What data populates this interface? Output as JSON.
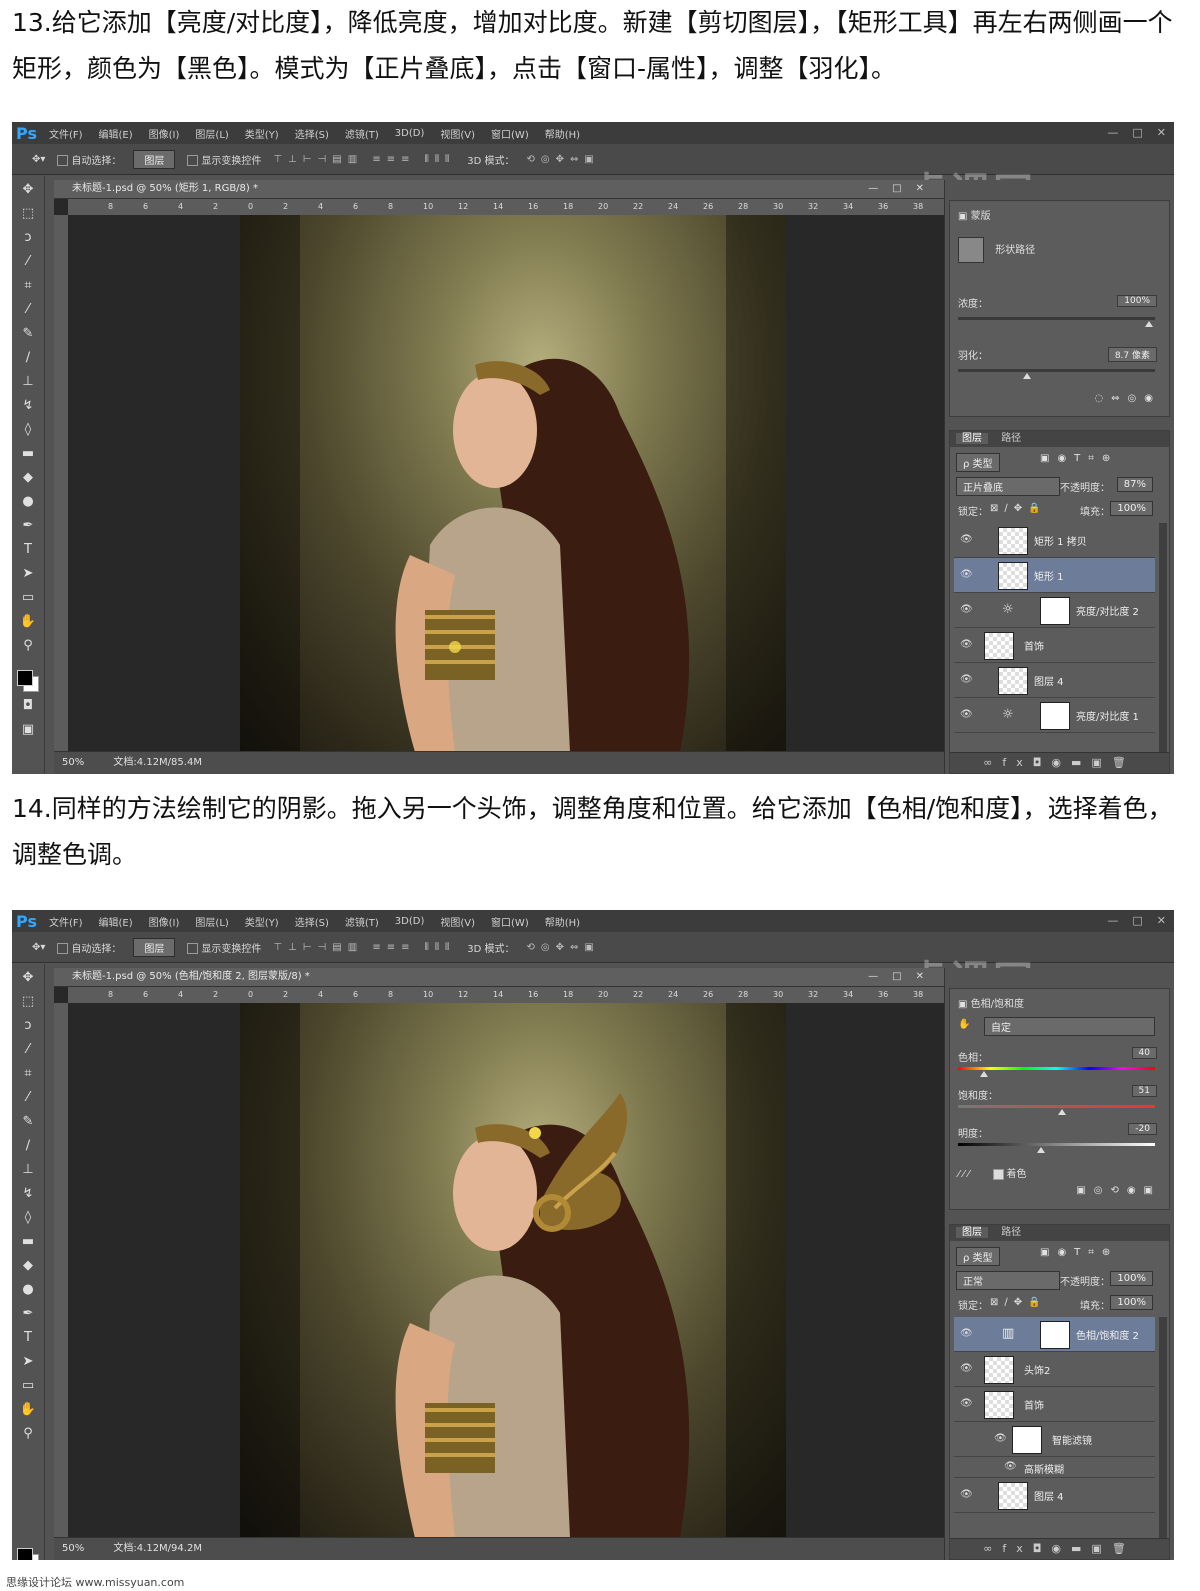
{
  "step13": {
    "text": "13.给它添加【亮度/对比度】，降低亮度，增加对比度。新建【剪切图层】，【矩形工具】再左右两侧画一个矩形，颜色为【黑色】。模式为【正片叠底】，点击【窗口-属性】，调整【羽化】。"
  },
  "step14": {
    "text": "14.同样的方法绘制它的阴影。拖入另一个头饰，调整角度和位置。给它添加【色相/饱和度】，选择着色，调整色调。"
  },
  "app": {
    "logo": "Ps",
    "menus": [
      "文件(F)",
      "编辑(E)",
      "图像(I)",
      "图层(L)",
      "类型(Y)",
      "选择(S)",
      "滤镜(T)",
      "3D(D)",
      "视图(V)",
      "窗口(W)",
      "帮助(H)"
    ],
    "window_controls": [
      "—",
      "□",
      "✕"
    ],
    "options": {
      "auto_select": "自动选择：",
      "auto_select_value": "图层",
      "show_transform": "显示变换控件",
      "mode_3d": "3D 模式："
    },
    "watermark": "虎课网",
    "ruler_ticks": [
      "8",
      "6",
      "4",
      "2",
      "0",
      "2",
      "4",
      "6",
      "8",
      "10",
      "12",
      "14",
      "16",
      "18",
      "20",
      "22",
      "24",
      "26",
      "28",
      "30",
      "32",
      "34",
      "36",
      "38"
    ]
  },
  "ss1": {
    "doc_title": "未标题-1.psd @ 50% (矩形 1, RGB/8) *",
    "zoom": "50%",
    "doc_size": "文档:4.12M/85.4M",
    "properties": {
      "type": "蒙版",
      "mask_label": "形状路径",
      "density_label": "浓度：",
      "density_value": "100%",
      "feather_label": "羽化：",
      "feather_value": "8.7 像素"
    },
    "layers_panel": {
      "tabs": [
        "图层",
        "路径"
      ],
      "filter": "ρ 类型",
      "blend_mode": "正片叠底",
      "opacity_label": "不透明度：",
      "opacity_value": "87%",
      "lock_label": "锁定：",
      "fill_label": "填充：",
      "fill_value": "100%"
    },
    "layers": [
      {
        "name": "矩形 1 拷贝",
        "kind": "shape"
      },
      {
        "name": "矩形 1",
        "kind": "shape"
      },
      {
        "name": "亮度/对比度 2",
        "kind": "adjustment"
      },
      {
        "name": "首饰",
        "kind": "pixel"
      },
      {
        "name": "图层 4",
        "kind": "pixel"
      },
      {
        "name": "亮度/对比度 1",
        "kind": "adjustment"
      }
    ],
    "selected_layer": 1
  },
  "ss2": {
    "doc_title": "未标题-1.psd @ 50% (色相/饱和度 2, 图层蒙版/8) *",
    "zoom": "50%",
    "doc_size": "文档:4.12M/94.2M",
    "properties": {
      "type": "色相/饱和度",
      "preset": "自定",
      "hue_label": "色相：",
      "hue_value": "40",
      "sat_label": "饱和度：",
      "sat_value": "51",
      "light_label": "明度：",
      "light_value": "-20",
      "colorize_label": "着色"
    },
    "layers_panel": {
      "tabs": [
        "图层",
        "路径"
      ],
      "filter": "ρ 类型",
      "blend_mode": "正常",
      "opacity_label": "不透明度：",
      "opacity_value": "100%",
      "lock_label": "锁定：",
      "fill_label": "填充：",
      "fill_value": "100%"
    },
    "layers": [
      {
        "name": "色相/饱和度 2",
        "kind": "adjustment"
      },
      {
        "name": "头饰2",
        "kind": "pixel"
      },
      {
        "name": "首饰",
        "kind": "pixel"
      },
      {
        "name": "智能滤镜",
        "kind": "filter"
      },
      {
        "name": "高斯模糊",
        "kind": "filter-item"
      },
      {
        "name": "图层 4",
        "kind": "pixel"
      }
    ],
    "selected_layer": 0
  },
  "footer": {
    "credit": "思缘设计论坛 www.missyuan.com"
  }
}
